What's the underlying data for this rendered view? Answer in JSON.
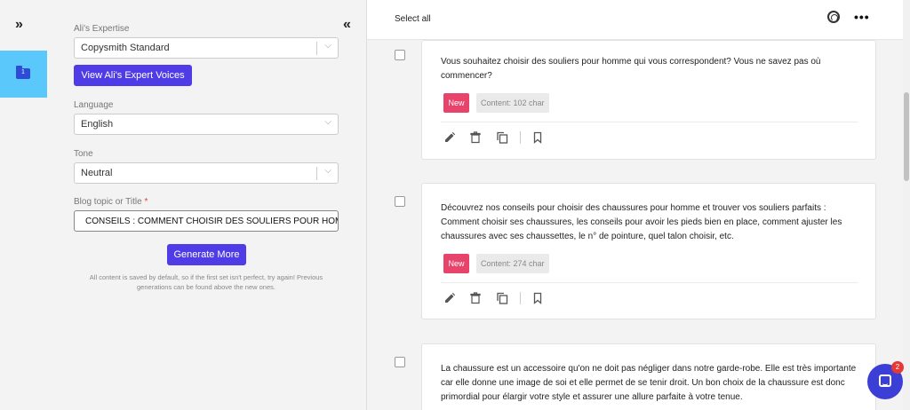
{
  "rail": {
    "expand_icon": "chevron-double-right",
    "folder_icon": "folder",
    "folder_badge": "1",
    "tile_color": "#5ac8fa"
  },
  "form": {
    "collapse_icon": "chevron-double-left",
    "expertise_label": "Ali's Expertise",
    "expertise_value": "Copysmith Standard",
    "expert_voices_button": "View Ali's Expert Voices",
    "language_label": "Language",
    "language_value": "English",
    "tone_label": "Tone",
    "tone_value": "Neutral",
    "topic_label": "Blog topic or Title",
    "topic_required_mark": "*",
    "topic_value": "CONSEILS : COMMENT CHOISIR DES SOULIERS POUR HOMME ADAPTES",
    "generate_button": "Generate More",
    "note": "All content is saved by default, so if the first set isn't perfect, try again! Previous generations can be found above the new ones.",
    "accent_color": "#4f3ce6"
  },
  "results": {
    "select_all": "Select all",
    "top_icons": [
      "fingerprint-icon",
      "more-icon"
    ],
    "more_glyph": "•••",
    "cards": [
      {
        "text": "Vous souhaitez choisir des souliers pour homme qui vous correspondent? Vous ne savez pas où commencer?",
        "badge": "New",
        "count": "Content: 102 char"
      },
      {
        "text": "Découvrez nos conseils pour choisir des chaussures pour homme et trouver vos souliers parfaits : Comment choisir ses chaussures, les conseils pour avoir les pieds bien en place, comment ajuster les chaussures avec ses chaussettes, le n° de pointure, quel talon choisir, etc.",
        "badge": "New",
        "count": "Content: 274 char"
      },
      {
        "text": "La chaussure est un accessoire qu'on ne doit pas négliger dans notre garde-robe. Elle est très importante car elle donne une image de soi et elle permet de se tenir droit. Un bon choix de la chaussure est donc primordial pour élargir votre style et assurer une allure parfaite à votre tenue."
      }
    ],
    "actions": [
      "edit-icon",
      "delete-icon",
      "copy-icon",
      "bookmark-icon"
    ],
    "badge_color": "#e8436b"
  },
  "chat": {
    "unread_count": "2"
  }
}
